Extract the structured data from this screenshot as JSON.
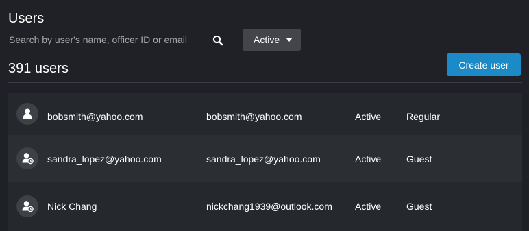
{
  "page": {
    "title": "Users"
  },
  "search": {
    "placeholder": "Search by user's name, officer ID or email",
    "value": ""
  },
  "filter": {
    "selected": "Active"
  },
  "summary": {
    "count": "391 users"
  },
  "actions": {
    "create_user": "Create user"
  },
  "users": [
    {
      "name": "bobsmith@yahoo.com",
      "email": "bobsmith@yahoo.com",
      "status": "Active",
      "role": "Regular",
      "avatar_icon": "user-icon"
    },
    {
      "name": "sandra_lopez@yahoo.com",
      "email": "sandra_lopez@yahoo.com",
      "status": "Active",
      "role": "Guest",
      "avatar_icon": "user-pending-icon"
    },
    {
      "name": "Nick Chang",
      "email": "nickchang1939@outlook.com",
      "status": "Active",
      "role": "Guest",
      "avatar_icon": "user-pending-icon"
    }
  ],
  "colors": {
    "background": "#1f2126",
    "row": "#25282d",
    "row_alt": "#2b2e33",
    "accent": "#1b8ac7",
    "dropdown": "#43454a"
  }
}
